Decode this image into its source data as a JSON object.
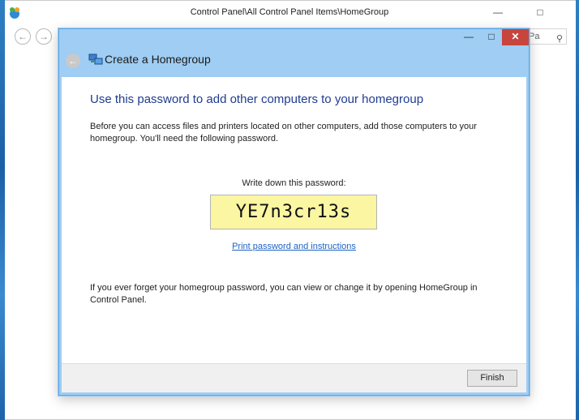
{
  "control_panel": {
    "title": "Control Panel\\All Control Panel Items\\HomeGroup",
    "minimize_glyph": "—",
    "maximize_glyph": "□",
    "back_glyph": "←",
    "forward_glyph": "→",
    "search_placeholder": "Pa",
    "search_icon_glyph": "⚲"
  },
  "dialog": {
    "title": "Create a Homegroup",
    "minimize_glyph": "—",
    "maximize_glyph": "□",
    "close_glyph": "✕",
    "back_glyph": "←",
    "heading": "Use this password to add other computers to your homegroup",
    "description": "Before you can access files and printers located on other computers, add those computers to your homegroup. You'll need the following password.",
    "password_label": "Write down this password:",
    "password": "YE7n3cr13s",
    "print_link": "Print password and instructions",
    "forget_text": "If you ever forget your homegroup password, you can view or change it by opening HomeGroup in Control Panel.",
    "finish_button": "Finish"
  },
  "colors": {
    "heading": "#1f3c91",
    "link": "#1c62c4",
    "password_bg": "#faf6a2",
    "frame": "#9fcdf3",
    "close": "#c7453d"
  }
}
